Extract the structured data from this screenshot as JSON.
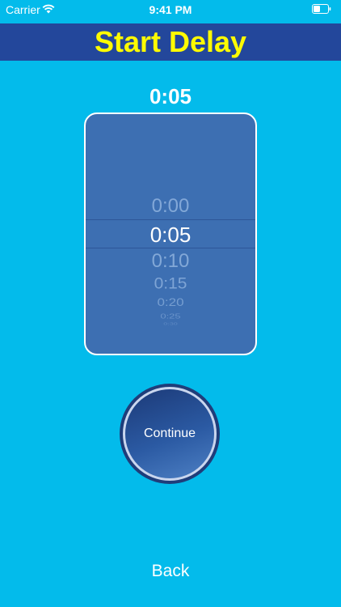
{
  "status_bar": {
    "carrier": "Carrier",
    "time": "9:41 PM",
    "wifi_icon": "wifi-icon",
    "battery_icon": "battery-icon"
  },
  "header": {
    "title": "Start Delay"
  },
  "picker": {
    "selected_value": "0:05",
    "options": [
      "0:00",
      "0:05",
      "0:10",
      "0:15",
      "0:20",
      "0:25",
      "0:30"
    ]
  },
  "actions": {
    "continue_label": "Continue",
    "back_label": "Back"
  },
  "colors": {
    "background": "#03bbeb",
    "header_bar": "#23479b",
    "title_text": "#fffb00",
    "picker_background": "#3d6fb2"
  }
}
